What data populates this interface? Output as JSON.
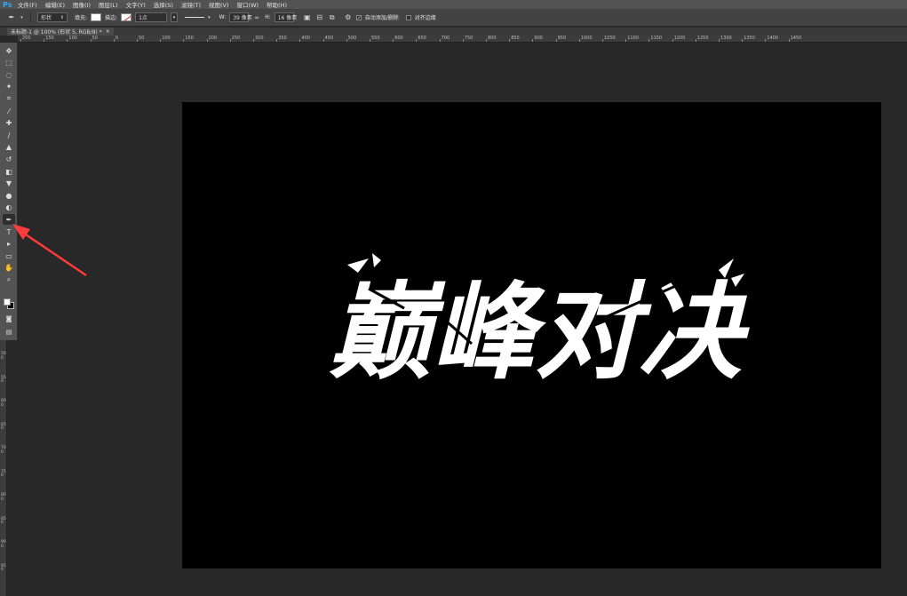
{
  "app": {
    "logo": "Ps"
  },
  "menu": [
    "文件(F)",
    "编辑(E)",
    "图像(I)",
    "图层(L)",
    "文字(Y)",
    "选择(S)",
    "滤镜(T)",
    "视图(V)",
    "窗口(W)",
    "帮助(H)"
  ],
  "options": {
    "mode_select": "形状",
    "fill_label": "填充:",
    "stroke_label": "描边:",
    "stroke_width": "1点",
    "w_label": "W:",
    "w_value": "39 像素",
    "h_label": "H:",
    "h_value": "16 像素",
    "auto_add_delete": "自动添加/删除",
    "auto_add_delete_checked": true,
    "align_edges": "对齐边缘",
    "align_edges_checked": false
  },
  "document_tab": {
    "title": "未标题-1 @ 100% (形状 5, RGB/8) *",
    "close": "×"
  },
  "ruler_h": [
    "200",
    "150",
    "100",
    "50",
    "0",
    "50",
    "100",
    "150",
    "200",
    "250",
    "300",
    "350",
    "400",
    "450",
    "500",
    "550",
    "600",
    "650",
    "700",
    "750",
    "800",
    "850",
    "900",
    "950",
    "1000",
    "1050",
    "1100",
    "1150",
    "1200",
    "1250",
    "1300",
    "1350",
    "1400",
    "1450"
  ],
  "ruler_v": [
    "500",
    "550",
    "600",
    "650",
    "700",
    "750",
    "800",
    "850",
    "900",
    "950"
  ],
  "tools": [
    {
      "name": "move-tool",
      "glyph": "✥"
    },
    {
      "name": "marquee-tool",
      "glyph": "⬚"
    },
    {
      "name": "lasso-tool",
      "glyph": "◌"
    },
    {
      "name": "quick-select-tool",
      "glyph": "✦"
    },
    {
      "name": "crop-tool",
      "glyph": "⌗"
    },
    {
      "name": "eyedropper-tool",
      "glyph": "⁄"
    },
    {
      "name": "spot-healing-tool",
      "glyph": "✚"
    },
    {
      "name": "brush-tool",
      "glyph": "∕"
    },
    {
      "name": "clone-stamp-tool",
      "glyph": "▲"
    },
    {
      "name": "history-brush-tool",
      "glyph": "↺"
    },
    {
      "name": "eraser-tool",
      "glyph": "◧"
    },
    {
      "name": "paint-bucket-tool",
      "glyph": "▼"
    },
    {
      "name": "blur-tool",
      "glyph": "●"
    },
    {
      "name": "dodge-tool",
      "glyph": "◐"
    },
    {
      "name": "pen-tool",
      "glyph": "✒"
    },
    {
      "name": "type-tool",
      "glyph": "T"
    },
    {
      "name": "path-select-tool",
      "glyph": "▸"
    },
    {
      "name": "rectangle-tool",
      "glyph": "▭"
    },
    {
      "name": "hand-tool",
      "glyph": "✋"
    },
    {
      "name": "zoom-tool",
      "glyph": "⌕"
    }
  ],
  "canvas": {
    "background": "#000000",
    "artwork_text": "巅峰对决",
    "artwork_color": "#ffffff"
  },
  "annotation": {
    "color": "#ff3b3b",
    "points_to": "pen-tool"
  }
}
